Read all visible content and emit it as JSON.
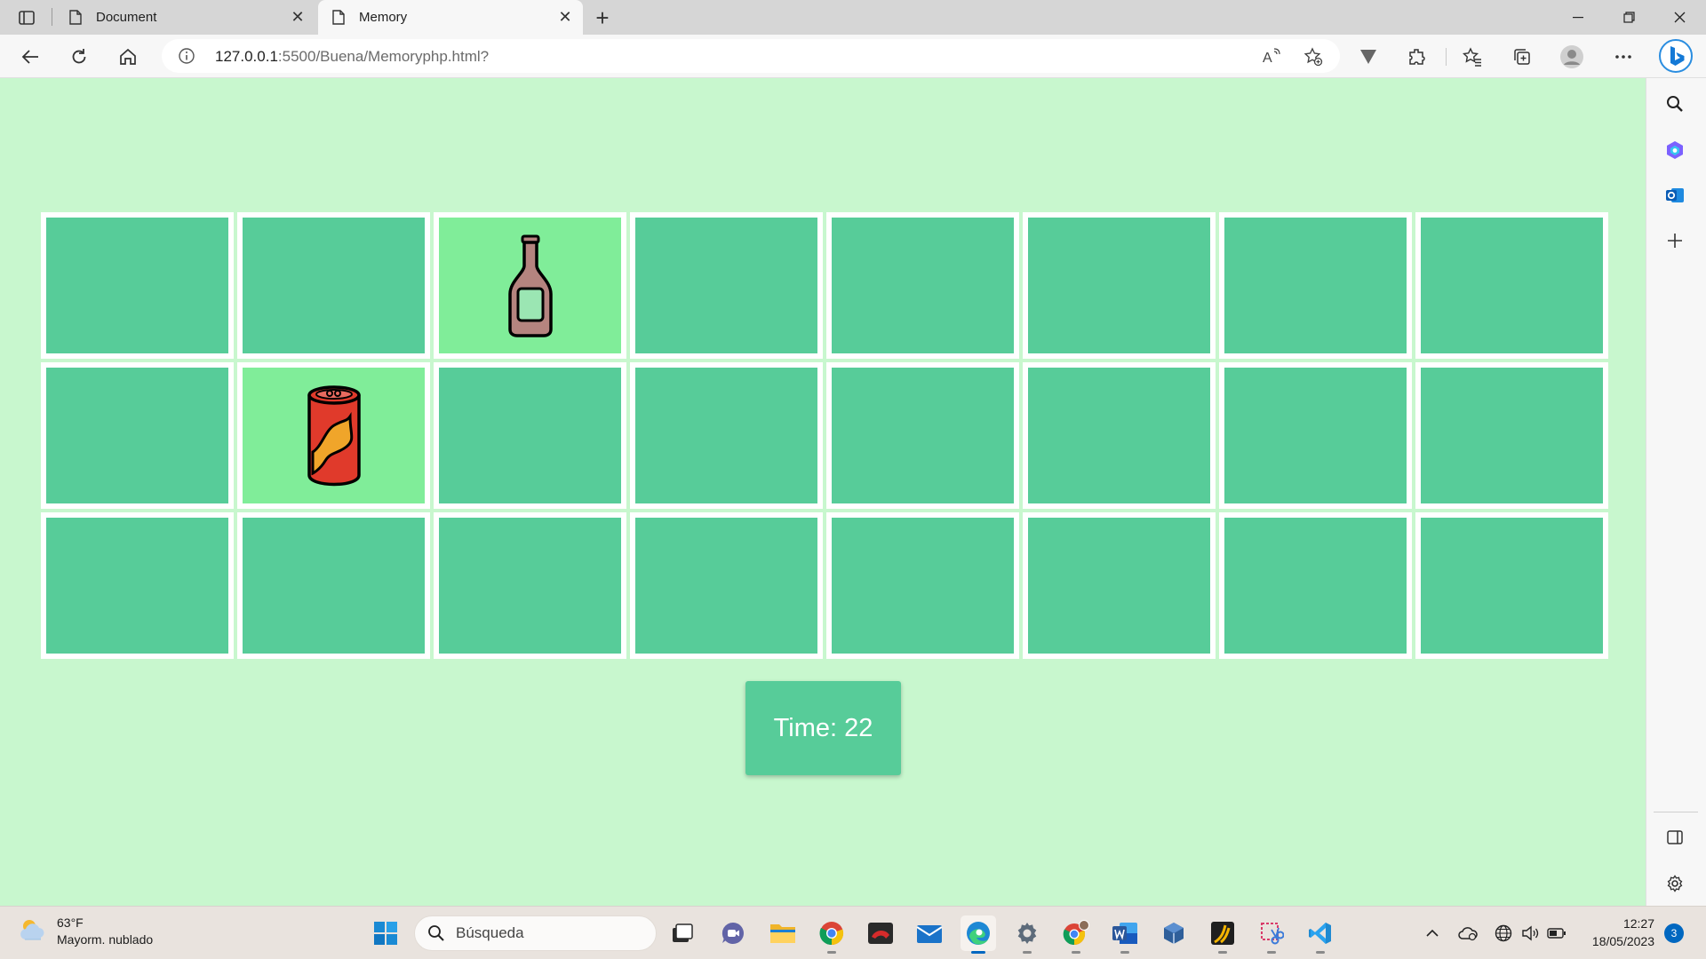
{
  "browser": {
    "tabs": [
      {
        "label": "Document",
        "active": false
      },
      {
        "label": "Memory",
        "active": true
      }
    ],
    "address": {
      "host": "127.0.0.1",
      "rest": ":5500/Buena/Memoryphp.html?"
    }
  },
  "game": {
    "columns": 8,
    "rows": 3,
    "cards": [
      {
        "state": "hidden"
      },
      {
        "state": "hidden"
      },
      {
        "state": "revealed",
        "image": "bottle"
      },
      {
        "state": "hidden"
      },
      {
        "state": "hidden"
      },
      {
        "state": "hidden"
      },
      {
        "state": "hidden"
      },
      {
        "state": "hidden"
      },
      {
        "state": "hidden"
      },
      {
        "state": "revealed",
        "image": "soda-can"
      },
      {
        "state": "hidden"
      },
      {
        "state": "hidden"
      },
      {
        "state": "hidden"
      },
      {
        "state": "hidden"
      },
      {
        "state": "hidden"
      },
      {
        "state": "hidden"
      },
      {
        "state": "hidden"
      },
      {
        "state": "hidden"
      },
      {
        "state": "hidden"
      },
      {
        "state": "hidden"
      },
      {
        "state": "hidden"
      },
      {
        "state": "hidden"
      },
      {
        "state": "hidden"
      },
      {
        "state": "hidden"
      }
    ],
    "timer_text": "Time: 22",
    "colors": {
      "background": "#c8f7ce",
      "card_back": "#57cc99",
      "card_revealed": "#80ed99",
      "card_border": "#ffffff"
    }
  },
  "taskbar": {
    "weather": {
      "temp": "63°F",
      "condition": "Mayorm. nublado"
    },
    "search_placeholder": "Búsqueda",
    "apps": [
      "start-icon",
      "task-view-icon",
      "teams-icon",
      "file-explorer-icon",
      "chrome-icon",
      "mediabox-icon",
      "mail-icon",
      "edge-icon",
      "settings-icon",
      "chrome-profile-icon",
      "word-icon",
      "virtualbox-icon",
      "xampp-icon",
      "snipping-tool-icon",
      "vscode-icon"
    ],
    "clock": {
      "time": "12:27",
      "date": "18/05/2023"
    },
    "notification_count": "3"
  }
}
